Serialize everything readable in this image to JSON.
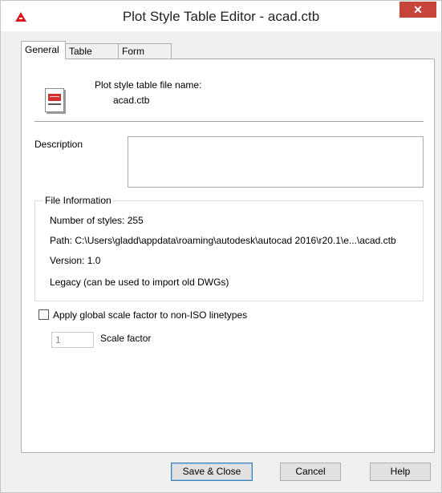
{
  "window": {
    "title": "Plot Style Table Editor - acad.ctb",
    "close_symbol": "✕",
    "app_icon": "autocad-logo-icon"
  },
  "tabs": [
    {
      "label": "General",
      "active": true
    },
    {
      "label": "Table View",
      "active": false
    },
    {
      "label": "Form View",
      "active": false
    }
  ],
  "general": {
    "file_icon": "plot-style-file-icon",
    "file_name_label": "Plot style table file name:",
    "file_name": "acad.ctb",
    "description_label": "Description",
    "description_value": "",
    "file_info": {
      "title": "File Information",
      "styles": "Number of styles: 255",
      "path": "Path: C:\\Users\\gladd\\appdata\\roaming\\autodesk\\autocad 2016\\r20.1\\e...\\acad.ctb",
      "version": "Version: 1.0",
      "legacy": "Legacy (can be used to import old DWGs)"
    },
    "apply_scale_label": "Apply global scale factor to non-ISO linetypes",
    "apply_scale_checked": false,
    "scale_value": "1",
    "scale_label": "Scale factor"
  },
  "buttons": {
    "save_close": "Save & Close",
    "cancel": "Cancel",
    "help": "Help"
  }
}
